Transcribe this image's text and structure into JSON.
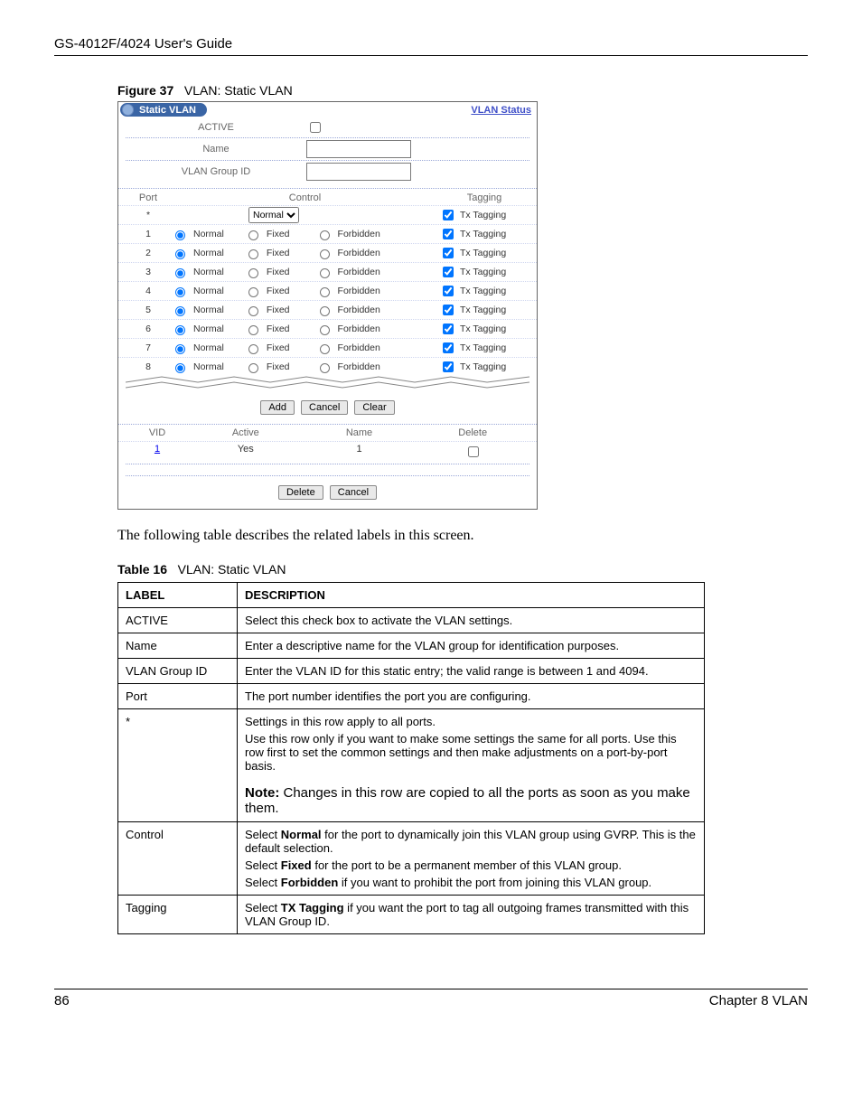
{
  "header": {
    "guide_title": "GS-4012F/4024 User's Guide"
  },
  "figure": {
    "number": "Figure 37",
    "title": "VLAN: Static VLAN"
  },
  "shot": {
    "pill_title": "Static VLAN",
    "link": "VLAN Status",
    "form": {
      "active_label": "ACTIVE",
      "name_label": "Name",
      "group_label": "VLAN Group ID"
    },
    "ports_header": {
      "port": "Port",
      "control": "Control",
      "tagging": "Tagging"
    },
    "star_row": {
      "port": "*",
      "select_value": "Normal",
      "tag_label": "Tx Tagging"
    },
    "rows": [
      {
        "port": "1",
        "normal": "Normal",
        "fixed": "Fixed",
        "forbidden": "Forbidden",
        "tag": "Tx Tagging"
      },
      {
        "port": "2",
        "normal": "Normal",
        "fixed": "Fixed",
        "forbidden": "Forbidden",
        "tag": "Tx Tagging"
      },
      {
        "port": "3",
        "normal": "Normal",
        "fixed": "Fixed",
        "forbidden": "Forbidden",
        "tag": "Tx Tagging"
      },
      {
        "port": "4",
        "normal": "Normal",
        "fixed": "Fixed",
        "forbidden": "Forbidden",
        "tag": "Tx Tagging"
      },
      {
        "port": "5",
        "normal": "Normal",
        "fixed": "Fixed",
        "forbidden": "Forbidden",
        "tag": "Tx Tagging"
      },
      {
        "port": "6",
        "normal": "Normal",
        "fixed": "Fixed",
        "forbidden": "Forbidden",
        "tag": "Tx Tagging"
      },
      {
        "port": "7",
        "normal": "Normal",
        "fixed": "Fixed",
        "forbidden": "Forbidden",
        "tag": "Tx Tagging"
      },
      {
        "port": "8",
        "normal": "Normal",
        "fixed": "Fixed",
        "forbidden": "Forbidden",
        "tag": "Tx Tagging"
      }
    ],
    "buttons": {
      "add": "Add",
      "cancel": "Cancel",
      "clear": "Clear",
      "delete": "Delete"
    },
    "list_header": {
      "vid": "VID",
      "active": "Active",
      "name": "Name",
      "delete": "Delete"
    },
    "list_row": {
      "vid": "1",
      "active": "Yes",
      "name": "1"
    }
  },
  "body_text": "The following table describes the related labels in this screen.",
  "table_caption": {
    "number": "Table 16",
    "title": "VLAN: Static VLAN"
  },
  "table": {
    "head": {
      "label": "LABEL",
      "desc": "DESCRIPTION"
    },
    "rows": [
      {
        "label": "ACTIVE",
        "desc": "Select this check box to activate the VLAN settings."
      },
      {
        "label": "Name",
        "desc": "Enter a descriptive name for the VLAN group for identification purposes."
      },
      {
        "label": "VLAN Group ID",
        "desc": "Enter the VLAN ID for this static entry; the valid range is between 1 and 4094."
      },
      {
        "label": "Port",
        "desc": "The port number identifies the port you are configuring."
      },
      {
        "label": "*",
        "desc_1": "Settings in this row apply to all ports.",
        "desc_2": "Use this row only if you want to make some settings the same for all ports. Use this row first to set the common settings and then make adjustments on a port-by-port basis.",
        "note_prefix": "Note:",
        "note_body": " Changes in this row are copied to all the ports as soon as you make them."
      },
      {
        "label": "Control",
        "p1a": "Select ",
        "p1b": "Normal",
        "p1c": " for the port to dynamically join this VLAN group using GVRP. This is the default selection.",
        "p2a": "Select ",
        "p2b": "Fixed",
        "p2c": " for the port to be a permanent member of this VLAN group.",
        "p3a": "Select ",
        "p3b": "Forbidden",
        "p3c": " if you want to prohibit the port from joining this VLAN group."
      },
      {
        "label": "Tagging",
        "p1a": "Select ",
        "p1b": "TX Tagging",
        "p1c": " if you want the port to tag all outgoing frames transmitted with this VLAN Group ID."
      }
    ]
  },
  "footer": {
    "page": "86",
    "chapter": "Chapter 8 VLAN"
  }
}
